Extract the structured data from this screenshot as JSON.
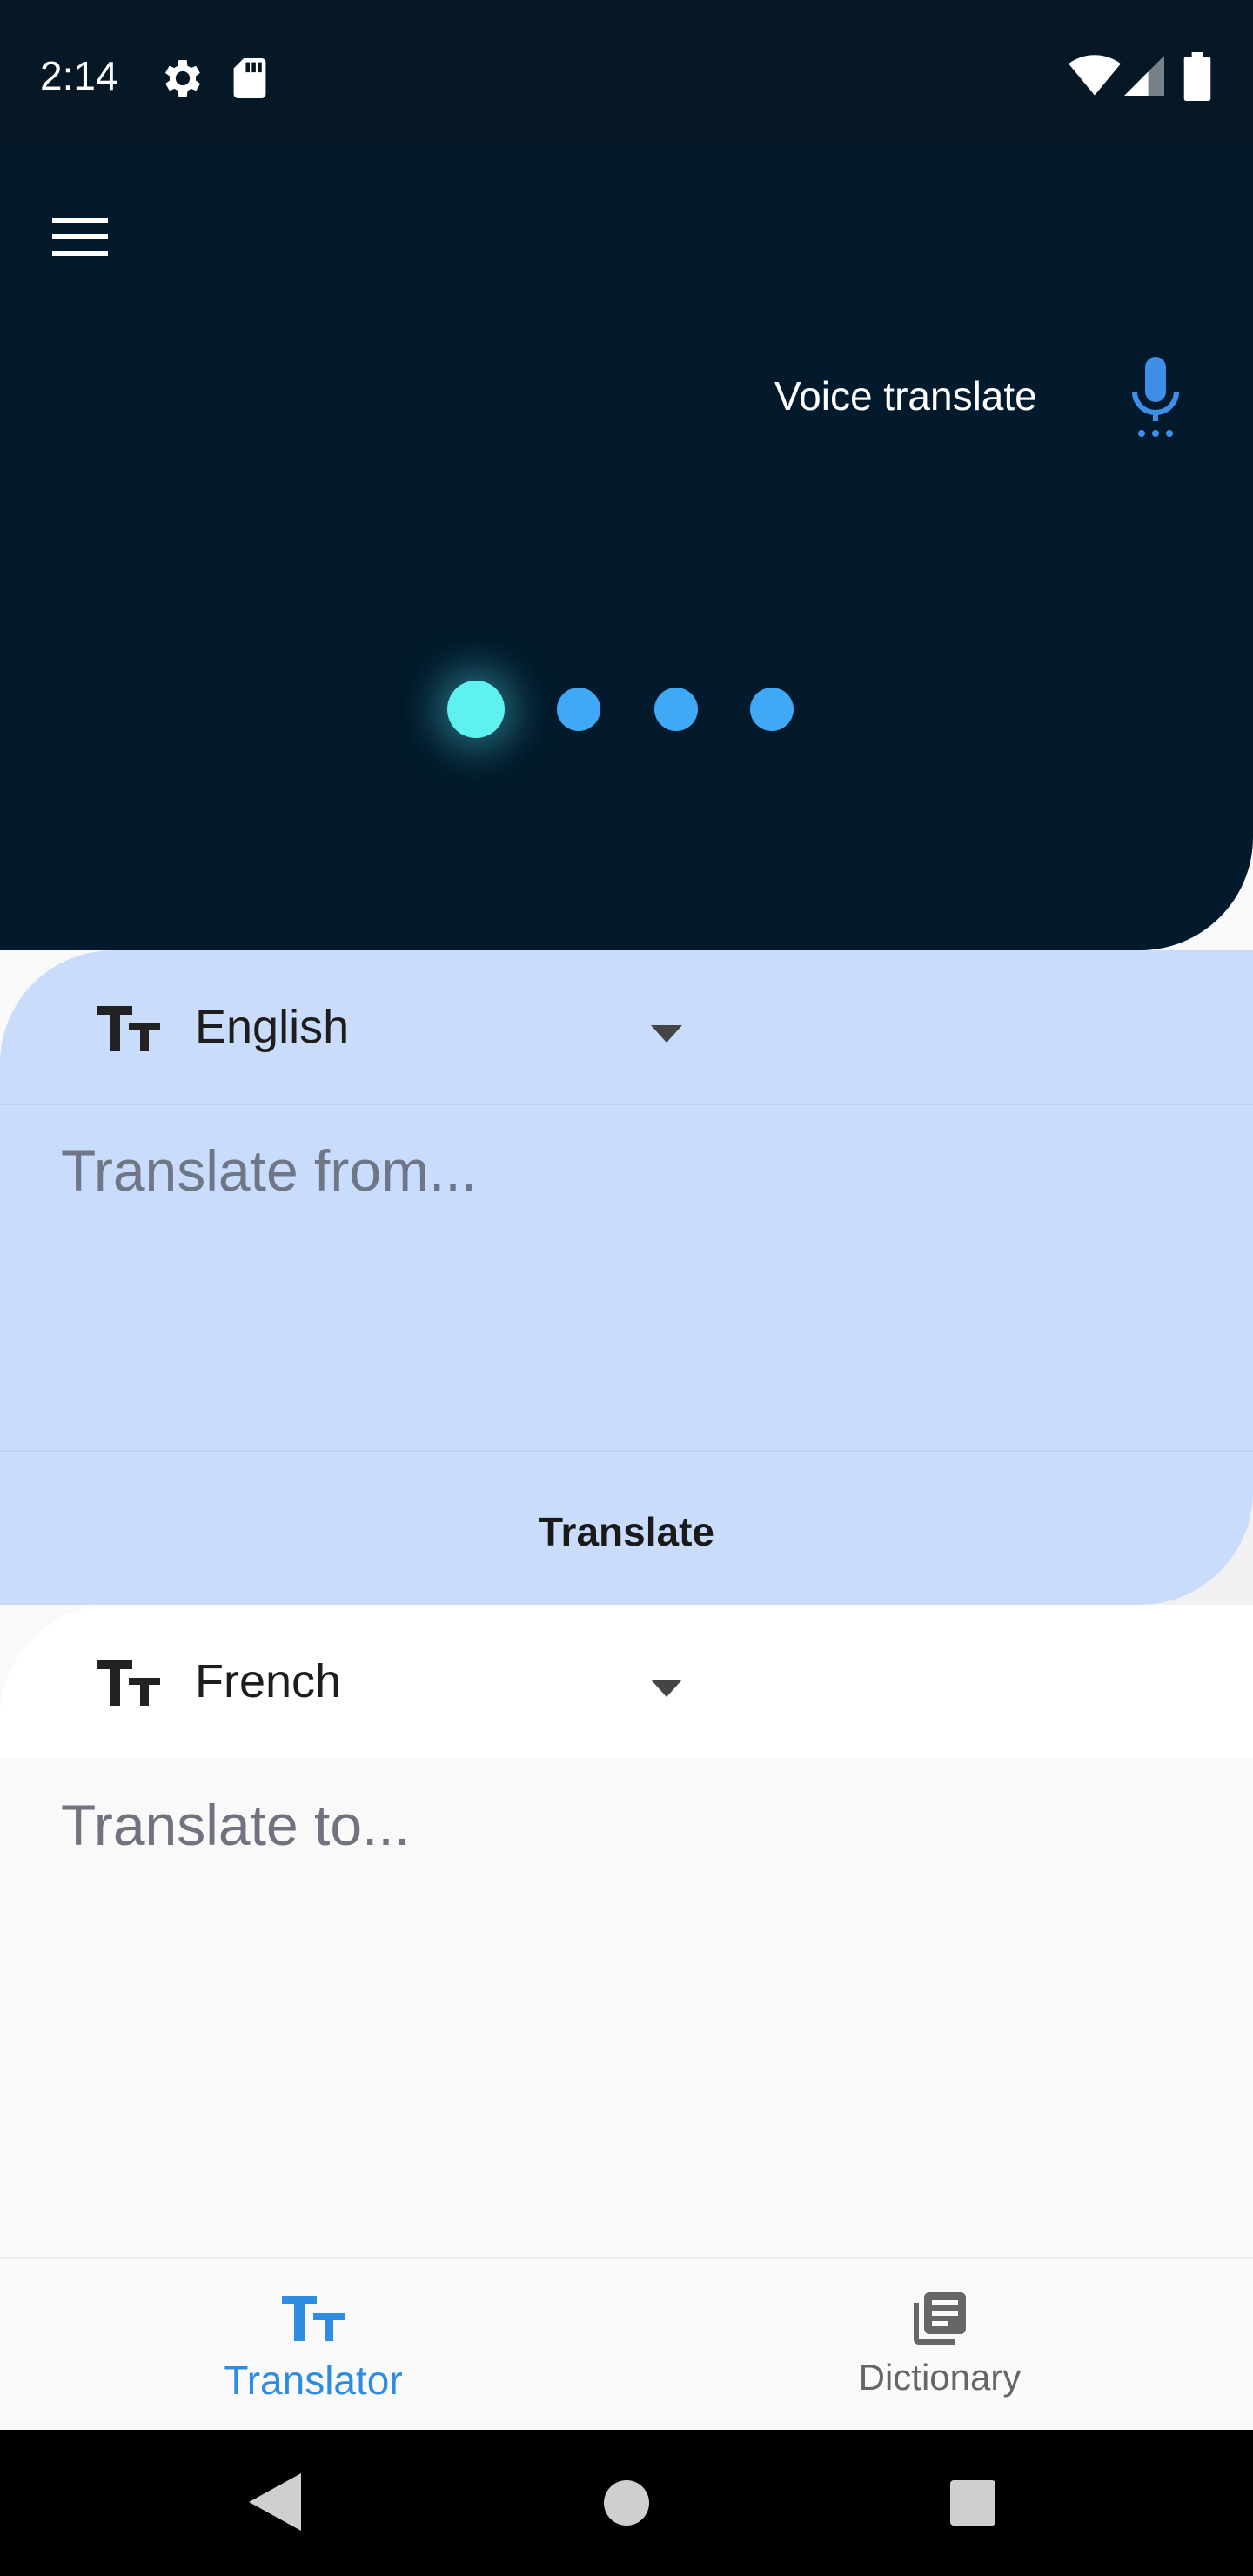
{
  "status_bar": {
    "time": "2:14",
    "icons": [
      "gear-icon",
      "sd-card-icon",
      "wifi-icon",
      "cell-signal-icon",
      "battery-icon"
    ]
  },
  "header": {
    "menu_icon": "hamburger-menu-icon",
    "voice_translate_label": "Voice translate",
    "mic_icon": "microphone-icon",
    "accent_color": "#3fa9f5",
    "page_indicator": {
      "count": 4,
      "active_index": 0,
      "active_color": "#5ff0f0"
    }
  },
  "source": {
    "language": "English",
    "placeholder": "Translate from...",
    "icon": "text-size-icon",
    "dropdown_icon": "caret-down-icon"
  },
  "translate_button": {
    "label": "Translate"
  },
  "target": {
    "language": "French",
    "placeholder": "Translate to...",
    "icon": "text-size-icon",
    "dropdown_icon": "caret-down-icon"
  },
  "bottom_nav": {
    "items": [
      {
        "label": "Translator",
        "icon": "text-size-icon",
        "active": true,
        "color": "#2e8de0"
      },
      {
        "label": "Dictionary",
        "icon": "library-books-icon",
        "active": false,
        "color": "#666666"
      }
    ]
  },
  "system_nav": {
    "icons": [
      "back-icon",
      "home-icon",
      "recents-icon"
    ]
  }
}
